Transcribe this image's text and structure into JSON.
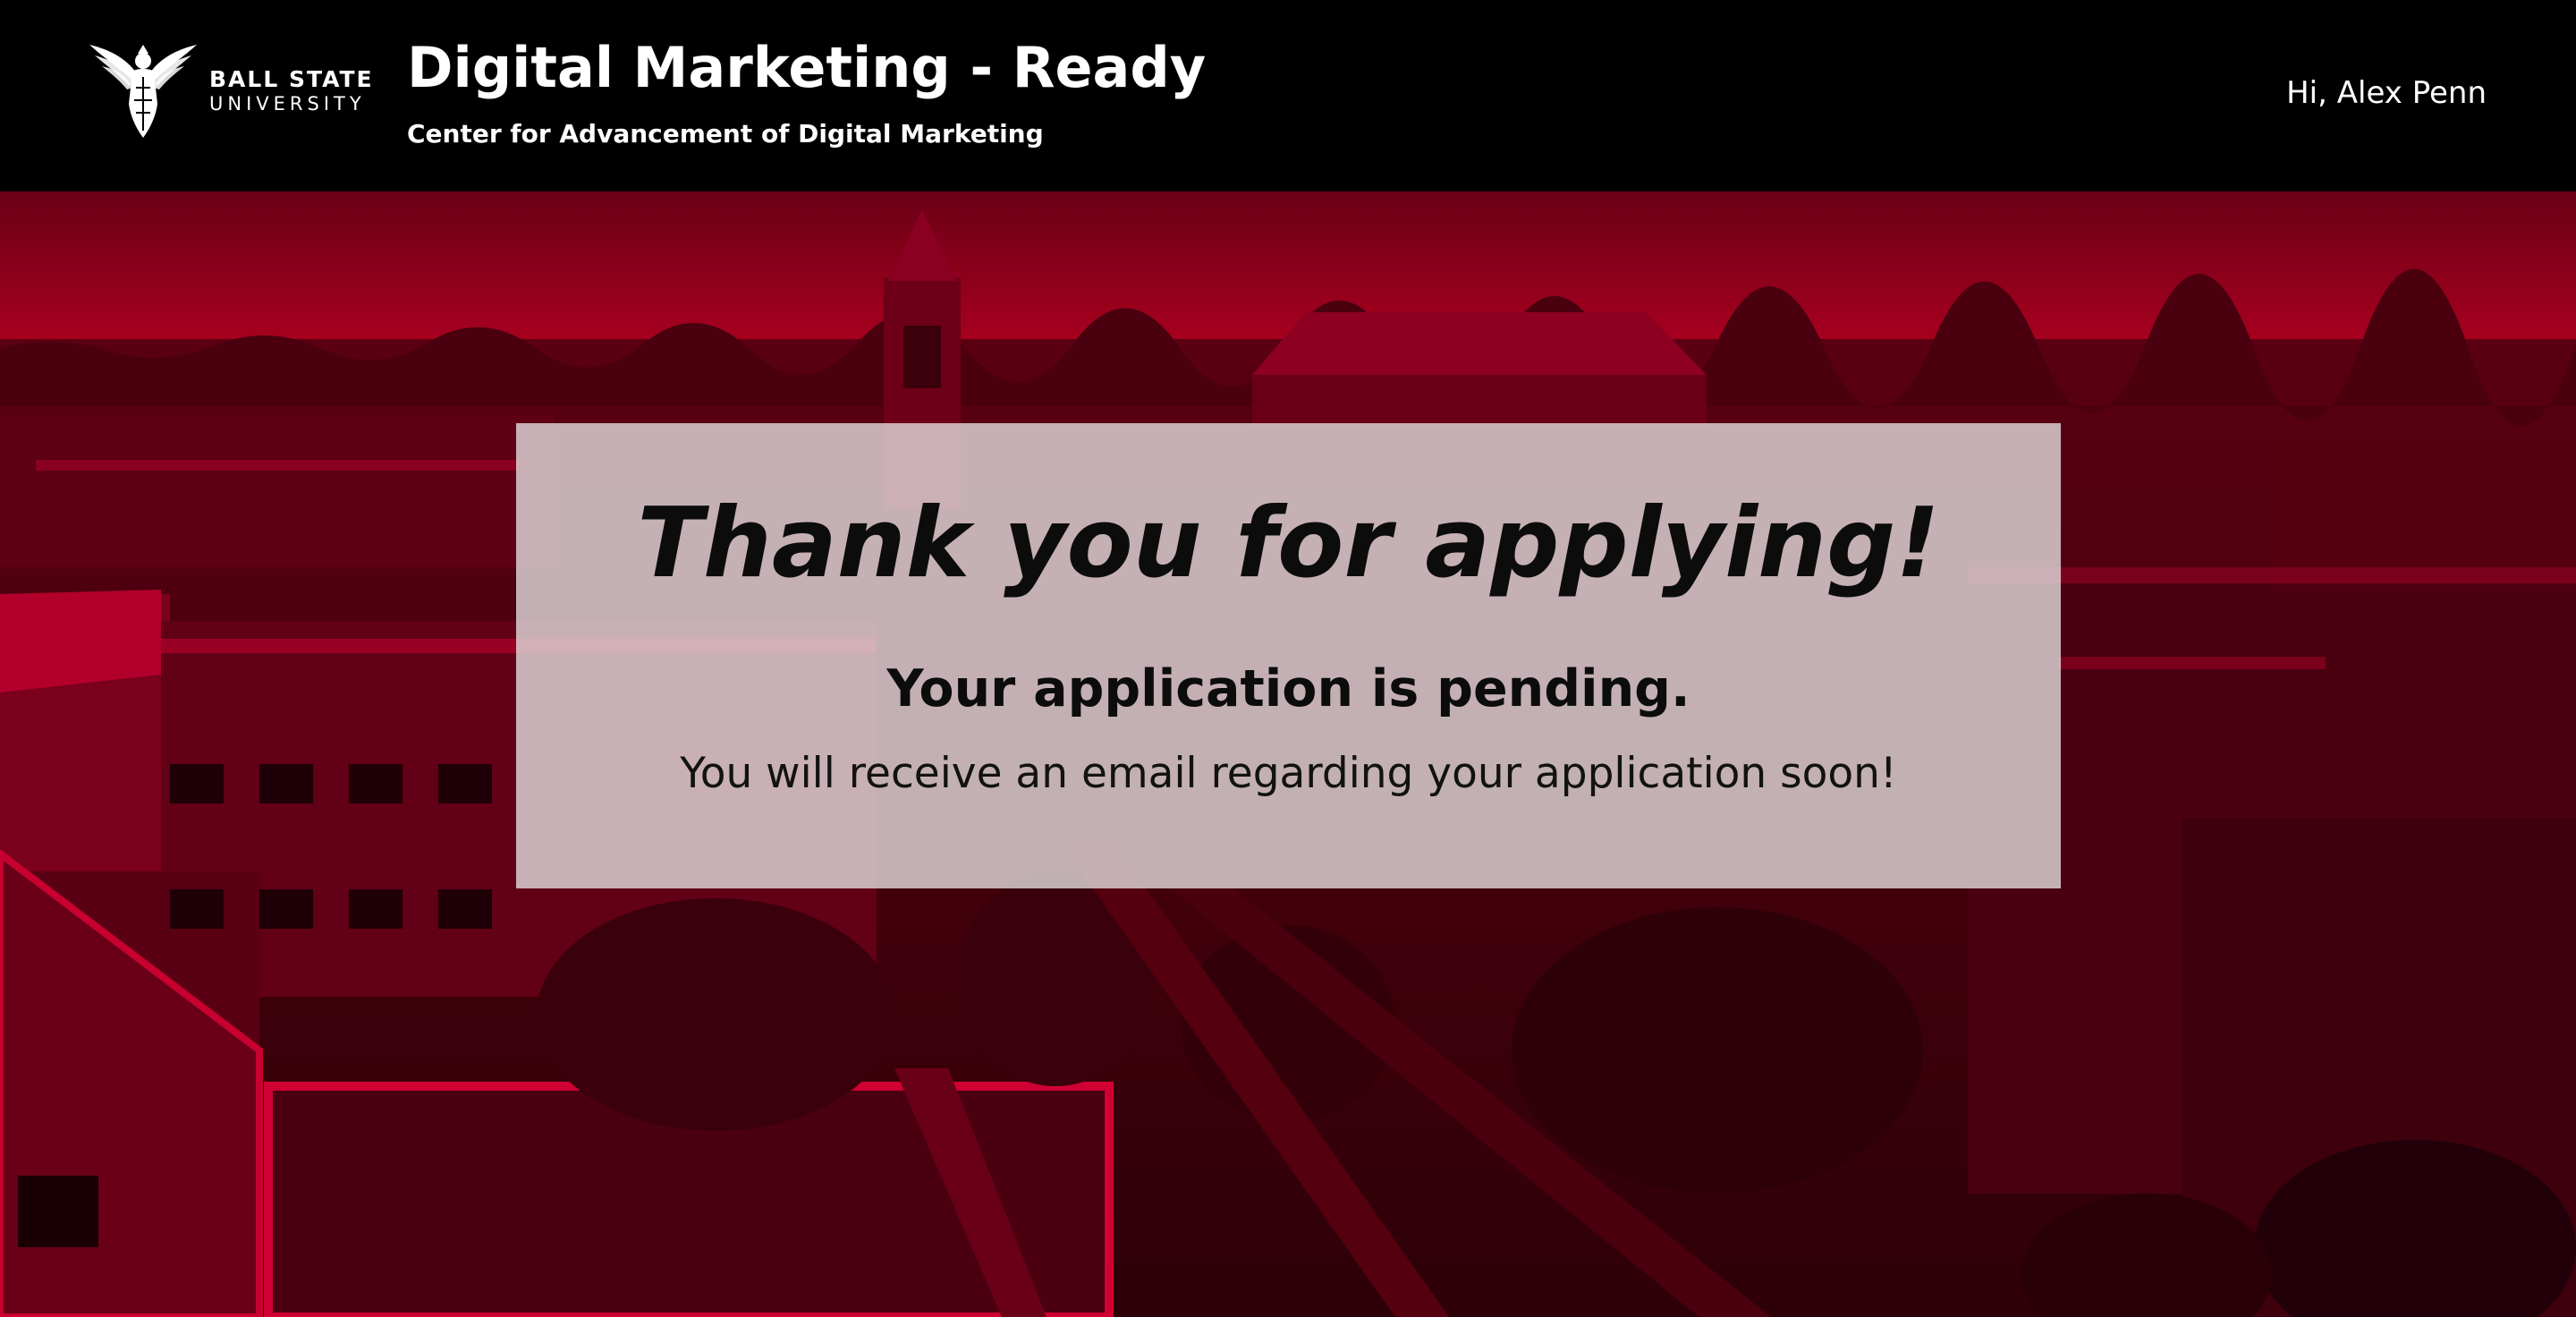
{
  "header": {
    "logo": {
      "line1": "BALL STATE",
      "line2": "UNIVERSITY",
      "icon": "cardinal-logo-icon"
    },
    "title": "Digital Marketing - Ready",
    "subtitle": "Center for Advancement of Digital Marketing",
    "greeting": "Hi, Alex Penn"
  },
  "confirmation": {
    "heading": "Thank you for applying!",
    "status": "Your application is pending.",
    "message": "You will receive an email regarding your application soon!"
  },
  "colors": {
    "header_bg": "#000000",
    "hero_tint": "#a0001f",
    "card_bg": "#e2dcdd"
  }
}
